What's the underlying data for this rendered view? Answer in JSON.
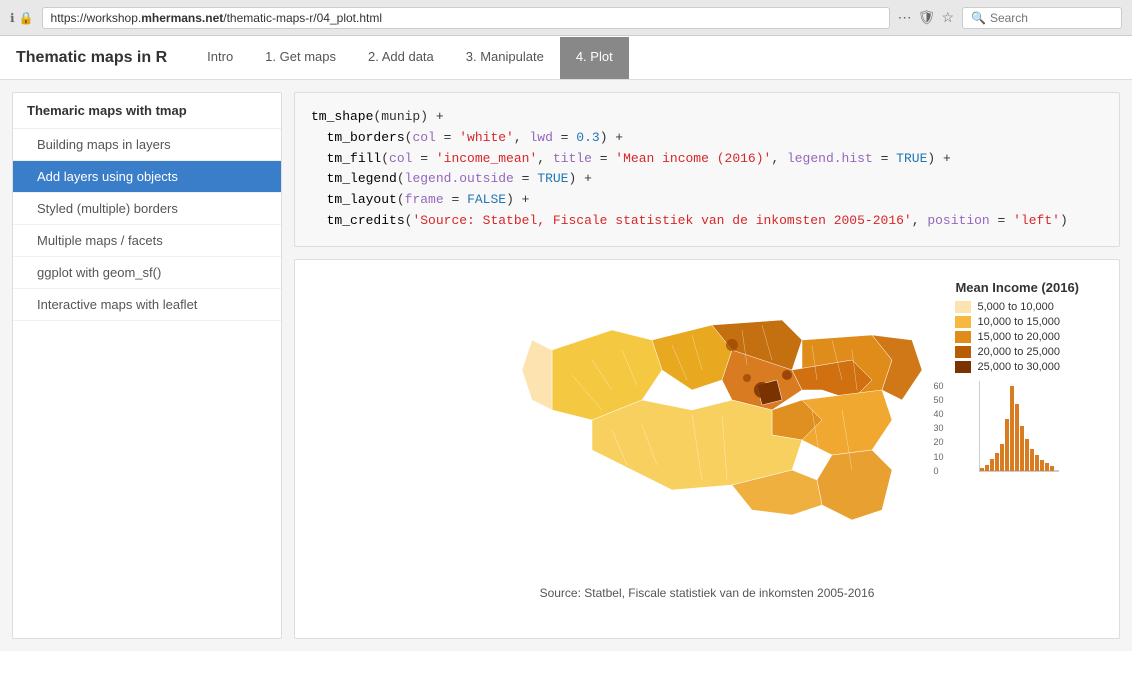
{
  "browser": {
    "url_secure": "🔒",
    "url_full": "https://workshop.mhermans.net/thematic-maps-r/04_plot.html",
    "url_domain": "mhermans.net",
    "url_path": "/thematic-maps-r/04_plot.html",
    "search_placeholder": "Search"
  },
  "site": {
    "title": "Thematic maps in R"
  },
  "nav": {
    "tabs": [
      {
        "id": "intro",
        "label": "Intro",
        "active": false
      },
      {
        "id": "get-maps",
        "label": "1. Get maps",
        "active": false
      },
      {
        "id": "add-data",
        "label": "2. Add data",
        "active": false
      },
      {
        "id": "manipulate",
        "label": "3. Manipulate",
        "active": false
      },
      {
        "id": "plot",
        "label": "4. Plot",
        "active": true
      }
    ]
  },
  "sidebar": {
    "section_header": "Themaric maps with tmap",
    "items": [
      {
        "id": "building-maps",
        "label": "Building maps in layers",
        "active": false
      },
      {
        "id": "add-layers",
        "label": "Add layers using objects",
        "active": true
      },
      {
        "id": "styled-borders",
        "label": "Styled (multiple) borders",
        "active": false
      },
      {
        "id": "multiple-maps",
        "label": "Multiple maps / facets",
        "active": false
      },
      {
        "id": "ggplot",
        "label": "ggplot with geom_sf()",
        "active": false
      },
      {
        "id": "interactive",
        "label": "Interactive maps with leaflet",
        "active": false
      }
    ]
  },
  "code": {
    "lines": [
      {
        "text": "tm_shape(munip) +",
        "parts": [
          {
            "type": "func",
            "text": "tm_shape"
          },
          {
            "type": "plain",
            "text": "(munip) +"
          }
        ]
      },
      {
        "text": "  tm_borders(col = 'white', lwd = 0.3) +",
        "parts": [
          {
            "type": "plain",
            "text": "  "
          },
          {
            "type": "func",
            "text": "tm_borders"
          },
          {
            "type": "plain",
            "text": "("
          },
          {
            "type": "param",
            "text": "col"
          },
          {
            "type": "plain",
            "text": " = "
          },
          {
            "type": "string",
            "text": "'white'"
          },
          {
            "type": "plain",
            "text": ", "
          },
          {
            "type": "param",
            "text": "lwd"
          },
          {
            "type": "plain",
            "text": " = "
          },
          {
            "type": "value",
            "text": "0.3"
          },
          {
            "type": "plain",
            "text": ") +"
          }
        ]
      },
      {
        "text": "  tm_fill(col = 'income_mean', title = 'Mean income (2016)', legend.hist = TRUE) +",
        "parts": [
          {
            "type": "plain",
            "text": "  "
          },
          {
            "type": "func",
            "text": "tm_fill"
          },
          {
            "type": "plain",
            "text": "("
          },
          {
            "type": "param",
            "text": "col"
          },
          {
            "type": "plain",
            "text": " = "
          },
          {
            "type": "string",
            "text": "'income_mean'"
          },
          {
            "type": "plain",
            "text": ", "
          },
          {
            "type": "param",
            "text": "title"
          },
          {
            "type": "plain",
            "text": " = "
          },
          {
            "type": "string",
            "text": "'Mean income (2016)'"
          },
          {
            "type": "plain",
            "text": ", "
          },
          {
            "type": "param",
            "text": "legend.hist"
          },
          {
            "type": "plain",
            "text": " = "
          },
          {
            "type": "value",
            "text": "TRUE"
          },
          {
            "type": "plain",
            "text": ") +"
          }
        ]
      },
      {
        "text": "  tm_legend(legend.outside = TRUE) +",
        "parts": [
          {
            "type": "plain",
            "text": "  "
          },
          {
            "type": "func",
            "text": "tm_legend"
          },
          {
            "type": "plain",
            "text": "("
          },
          {
            "type": "param",
            "text": "legend.outside"
          },
          {
            "type": "plain",
            "text": " = "
          },
          {
            "type": "value",
            "text": "TRUE"
          },
          {
            "type": "plain",
            "text": ") +"
          }
        ]
      },
      {
        "text": "  tm_layout(frame = FALSE) +",
        "parts": [
          {
            "type": "plain",
            "text": "  "
          },
          {
            "type": "func",
            "text": "tm_layout"
          },
          {
            "type": "plain",
            "text": "("
          },
          {
            "type": "param",
            "text": "frame"
          },
          {
            "type": "plain",
            "text": " = "
          },
          {
            "type": "value",
            "text": "FALSE"
          },
          {
            "type": "plain",
            "text": ") +"
          }
        ]
      },
      {
        "text": "  tm_credits('Source: Statbel, Fiscale statistiek van de inkomsten 2005-2016', position = 'left')",
        "parts": [
          {
            "type": "plain",
            "text": "  "
          },
          {
            "type": "func",
            "text": "tm_credits"
          },
          {
            "type": "plain",
            "text": "("
          },
          {
            "type": "string",
            "text": "'Source: Statbel, Fiscale statistiek van de inkomsten 2005-2016'"
          },
          {
            "type": "plain",
            "text": ", "
          },
          {
            "type": "param",
            "text": "position"
          },
          {
            "type": "plain",
            "text": " = "
          },
          {
            "type": "string",
            "text": "'left'"
          },
          {
            "type": "plain",
            "text": ")"
          }
        ]
      }
    ]
  },
  "legend": {
    "title": "Mean Income (2016)",
    "items": [
      {
        "label": "5,000 to 10,000",
        "color": "#fde3b0"
      },
      {
        "label": "10,000 to 15,000",
        "color": "#f5b942"
      },
      {
        "label": "15,000 to 20,000",
        "color": "#e08c1a"
      },
      {
        "label": "20,000 to 25,000",
        "color": "#b85d05"
      },
      {
        "label": "25,000 to 30,000",
        "color": "#7a3200"
      }
    ]
  },
  "histogram": {
    "y_labels": [
      "60",
      "50",
      "40",
      "30",
      "20",
      "10",
      "0"
    ],
    "bars": [
      2,
      4,
      8,
      12,
      18,
      35,
      58,
      42,
      28,
      20,
      12,
      8,
      5,
      3,
      2
    ],
    "label": ""
  },
  "caption": "Source: Statbel, Fiscale statistiek van de inkomsten 2005-2016"
}
